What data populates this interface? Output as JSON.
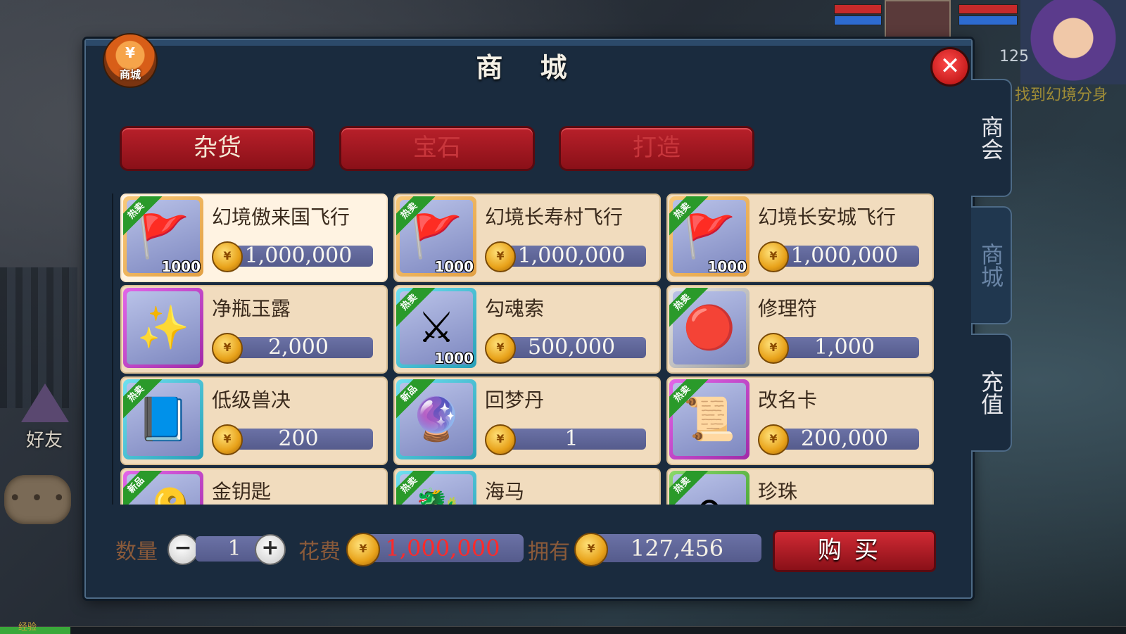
{
  "window": {
    "title": "商 城",
    "badge_symbol": "¥",
    "badge_label": "商城",
    "close_symbol": "✕"
  },
  "tabs": [
    {
      "label": "杂货",
      "active": true
    },
    {
      "label": "宝石",
      "active": false
    },
    {
      "label": "打造",
      "active": false
    }
  ],
  "side_tabs": [
    {
      "label": "商会"
    },
    {
      "label": "商城",
      "active": true
    },
    {
      "label": "充值"
    }
  ],
  "items": [
    {
      "name": "幻境傲来国飞行",
      "price": "1,000,000",
      "qty": "1000",
      "tag": "热卖",
      "icon": "flag-icon",
      "rarity": "orange",
      "selected": true
    },
    {
      "name": "幻境长寿村飞行",
      "price": "1,000,000",
      "qty": "1000",
      "tag": "热卖",
      "icon": "flag-icon",
      "rarity": "orange"
    },
    {
      "name": "幻境长安城飞行",
      "price": "1,000,000",
      "qty": "1000",
      "tag": "热卖",
      "icon": "flag-icon",
      "rarity": "orange"
    },
    {
      "name": "净瓶玉露",
      "price": "2,000",
      "qty": "",
      "tag": "",
      "icon": "vase-icon",
      "rarity": "purple"
    },
    {
      "name": "勾魂索",
      "price": "500,000",
      "qty": "1000",
      "tag": "热卖",
      "icon": "swords-icon",
      "rarity": "cyan"
    },
    {
      "name": "修理符",
      "price": "1,000",
      "qty": "",
      "tag": "热卖",
      "icon": "orb-icon",
      "rarity": "silver"
    },
    {
      "name": "低级兽决",
      "price": "200",
      "qty": "",
      "tag": "热卖",
      "icon": "book-icon",
      "rarity": "cyan"
    },
    {
      "name": "回梦丹",
      "price": "1",
      "qty": "",
      "tag": "新品",
      "icon": "chest-icon",
      "rarity": "cyan"
    },
    {
      "name": "改名卡",
      "price": "200,000",
      "qty": "",
      "tag": "热卖",
      "icon": "scroll-icon",
      "rarity": "purple"
    },
    {
      "name": "金钥匙",
      "price": "",
      "qty": "",
      "tag": "新品",
      "icon": "key-icon",
      "rarity": "purple"
    },
    {
      "name": "海马",
      "price": "",
      "qty": "",
      "tag": "热卖",
      "icon": "seahorse-icon",
      "rarity": "cyan"
    },
    {
      "name": "珍珠",
      "price": "",
      "qty": "",
      "tag": "热卖",
      "icon": "pearl-icon",
      "rarity": "green"
    }
  ],
  "purchase": {
    "quantity_label": "数量",
    "quantity": "1",
    "minus": "−",
    "plus": "+",
    "cost_label": "花费",
    "cost": "1,000,000",
    "own_label": "拥有",
    "own": "127,456",
    "buy_label": "购买"
  },
  "hud": {
    "level": "125",
    "quest_text": "找到幻境分身",
    "friend_label": "好友",
    "exp_label": "经验",
    "chat_dots": "• • •"
  },
  "colors": {
    "accent_red": "#b8202a",
    "price_red": "#ff2a2a",
    "panel": "#1a2b3e"
  }
}
